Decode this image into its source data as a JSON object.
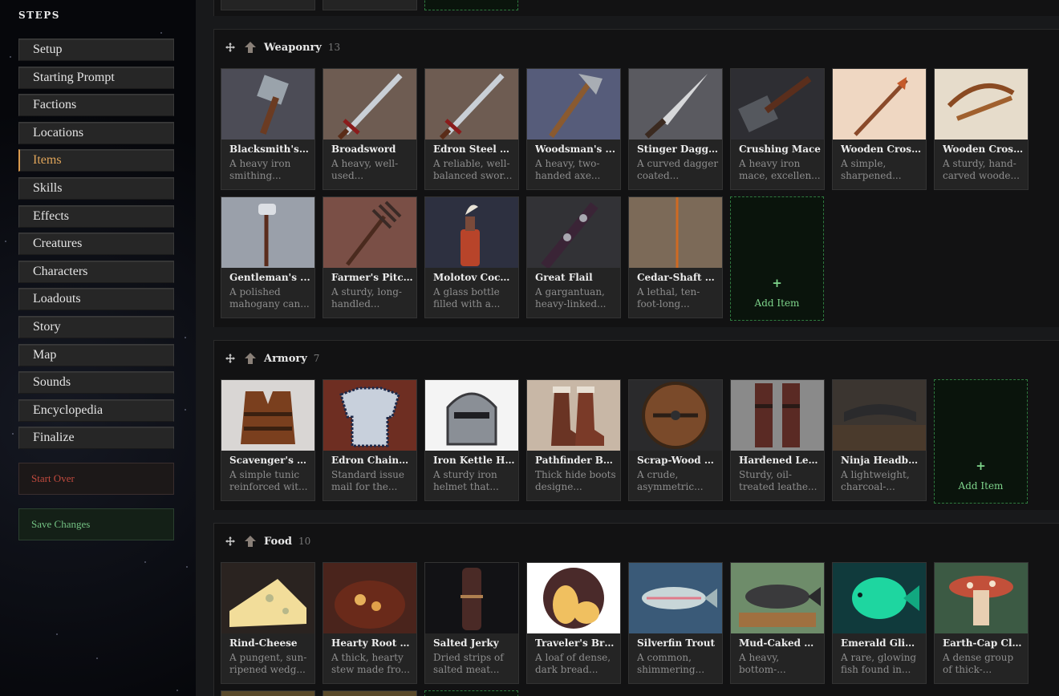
{
  "sidebar": {
    "title": "STEPS",
    "steps": [
      {
        "label": "Setup"
      },
      {
        "label": "Starting Prompt"
      },
      {
        "label": "Factions"
      },
      {
        "label": "Locations"
      },
      {
        "label": "Items"
      },
      {
        "label": "Skills"
      },
      {
        "label": "Effects"
      },
      {
        "label": "Creatures"
      },
      {
        "label": "Characters"
      },
      {
        "label": "Loadouts"
      },
      {
        "label": "Story"
      },
      {
        "label": "Map"
      },
      {
        "label": "Sounds"
      },
      {
        "label": "Encyclopedia"
      },
      {
        "label": "Finalize"
      }
    ],
    "active_step": "Items",
    "start_over_label": "Start Over",
    "save_changes_label": "Save Changes"
  },
  "add_item_label": "Add Item",
  "add_item_plus": "+",
  "sections": [
    {
      "title": "Weaponry",
      "count": "13",
      "items": [
        {
          "name": "Blacksmith's ...",
          "desc": "A heavy iron smithing...",
          "icon": "hammer"
        },
        {
          "name": "Broadsword",
          "desc": "A heavy, well-used...",
          "icon": "sword"
        },
        {
          "name": "Edron Steel Lo...",
          "desc": "A reliable, well-balanced swor...",
          "icon": "sword"
        },
        {
          "name": "Woodsman's ...",
          "desc": "A heavy, two-handed axe...",
          "icon": "axe"
        },
        {
          "name": "Stinger Dagger",
          "desc": "A curved dagger coated...",
          "icon": "dagger"
        },
        {
          "name": "Crushing Mace",
          "desc": "A heavy iron mace, excellen...",
          "icon": "mace"
        },
        {
          "name": "Wooden Cross...",
          "desc": "A simple, sharpened...",
          "icon": "spear"
        },
        {
          "name": "Wooden Cross...",
          "desc": "A sturdy, hand-carved woode...",
          "icon": "crossbow"
        },
        {
          "name": "Gentleman's ...",
          "desc": "A polished mahogany can...",
          "icon": "cane"
        },
        {
          "name": "Farmer's Pitc...",
          "desc": "A sturdy, long-handled...",
          "icon": "pitchfork"
        },
        {
          "name": "Molotov Cockt...",
          "desc": "A glass bottle filled with a...",
          "icon": "bottle"
        },
        {
          "name": "Great Flail",
          "desc": "A gargantuan, heavy-linked...",
          "icon": "flail"
        },
        {
          "name": "Cedar-Shaft P...",
          "desc": "A lethal, ten-foot-long...",
          "icon": "pike"
        }
      ]
    },
    {
      "title": "Armory",
      "count": "7",
      "items": [
        {
          "name": "Scavenger's L...",
          "desc": "A simple tunic reinforced wit...",
          "icon": "vest"
        },
        {
          "name": "Edron Chainm...",
          "desc": "Standard issue mail for the...",
          "icon": "chainmail"
        },
        {
          "name": "Iron Kettle He...",
          "desc": "A sturdy iron helmet that...",
          "icon": "helmet"
        },
        {
          "name": "Pathfinder Bo...",
          "desc": "Thick hide boots designe...",
          "icon": "boots"
        },
        {
          "name": "Scrap-Wood B...",
          "desc": "A crude, asymmetric...",
          "icon": "shield"
        },
        {
          "name": "Hardened Lea...",
          "desc": "Sturdy, oil-treated leathe...",
          "icon": "greaves"
        },
        {
          "name": "Ninja Headba...",
          "desc": "A lightweight, charcoal-...",
          "icon": "headband"
        }
      ]
    },
    {
      "title": "Food",
      "count": "10",
      "items": [
        {
          "name": "Rind-Cheese",
          "desc": "A pungent, sun-ripened wedg...",
          "icon": "cheese"
        },
        {
          "name": "Hearty Root S...",
          "desc": "A thick, hearty stew made fro...",
          "icon": "stew"
        },
        {
          "name": "Salted Jerky",
          "desc": "Dried strips of salted meat...",
          "icon": "jerky"
        },
        {
          "name": "Traveler's Bre...",
          "desc": "A loaf of dense, dark bread...",
          "icon": "bread"
        },
        {
          "name": "Silverfin Trout",
          "desc": "A common, shimmering...",
          "icon": "fish"
        },
        {
          "name": "Mud-Caked C...",
          "desc": "A heavy, bottom-...",
          "icon": "catfish"
        },
        {
          "name": "Emerald Glim...",
          "desc": "A rare, glowing fish found in...",
          "icon": "glowfish"
        },
        {
          "name": "Earth-Cap Clu...",
          "desc": "A dense group of thick-...",
          "icon": "mushroom"
        }
      ]
    }
  ]
}
